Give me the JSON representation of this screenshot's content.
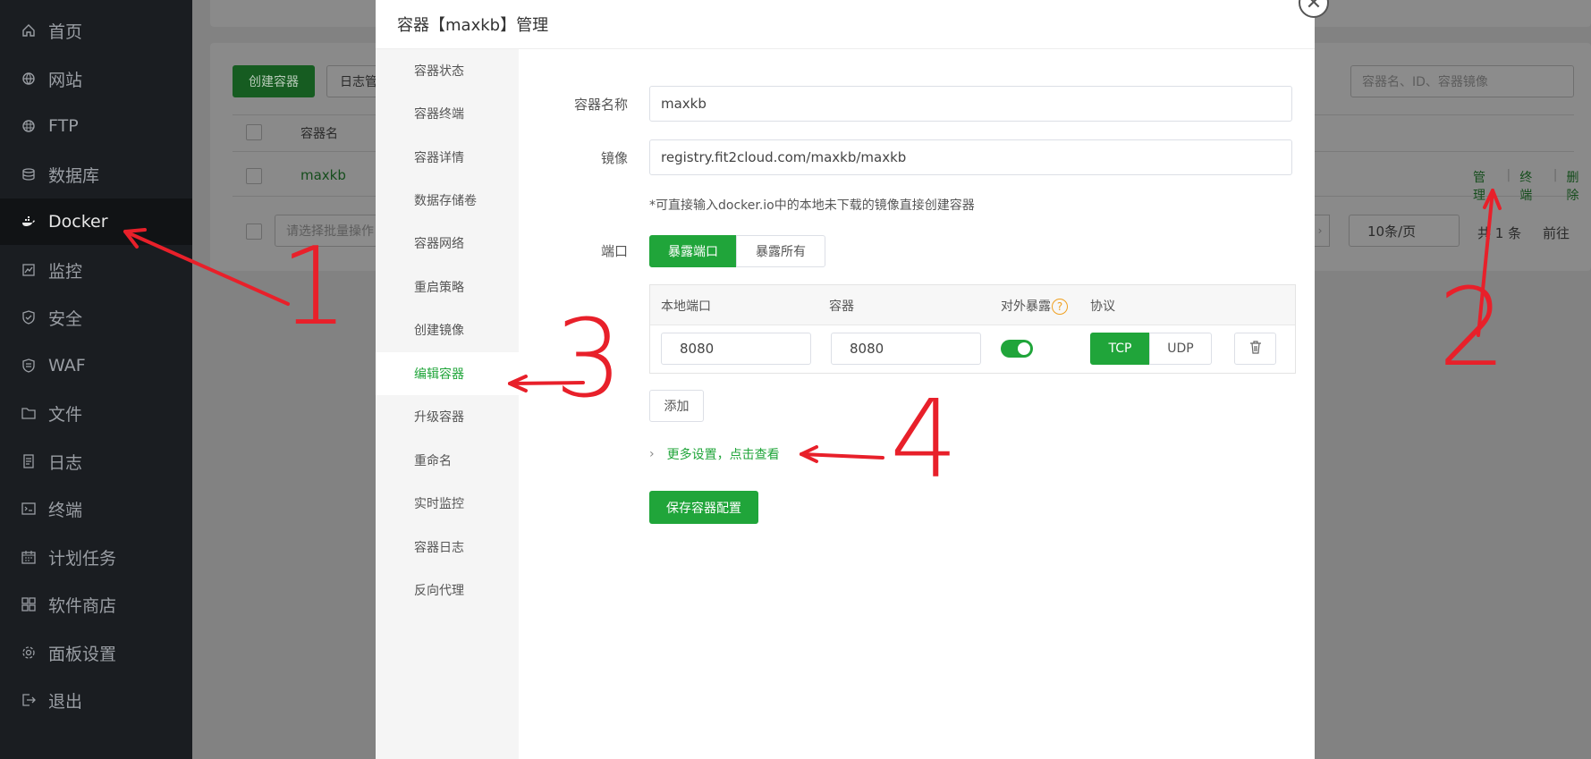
{
  "sidebar": {
    "items": [
      {
        "label": "首页",
        "icon": "home-icon"
      },
      {
        "label": "网站",
        "icon": "globe-icon"
      },
      {
        "label": "FTP",
        "icon": "ftp-icon"
      },
      {
        "label": "数据库",
        "icon": "database-icon"
      },
      {
        "label": "Docker",
        "icon": "docker-icon",
        "active": true
      },
      {
        "label": "监控",
        "icon": "monitor-icon"
      },
      {
        "label": "安全",
        "icon": "shield-icon"
      },
      {
        "label": "WAF",
        "icon": "waf-icon"
      },
      {
        "label": "文件",
        "icon": "folder-icon"
      },
      {
        "label": "日志",
        "icon": "log-icon"
      },
      {
        "label": "终端",
        "icon": "terminal-icon"
      },
      {
        "label": "计划任务",
        "icon": "calendar-icon"
      },
      {
        "label": "软件商店",
        "icon": "apps-icon"
      },
      {
        "label": "面板设置",
        "icon": "gear-icon"
      },
      {
        "label": "退出",
        "icon": "logout-icon"
      }
    ]
  },
  "background": {
    "create_button": "创建容器",
    "log_button": "日志管",
    "search_placeholder": "容器名、ID、容器镜像",
    "column_name": "容器名",
    "row_name": "maxkb",
    "actions": [
      "管理",
      "终端",
      "删除"
    ],
    "batch_placeholder": "请选择批量操作",
    "page_size": "10条/页",
    "total": "共 1 条",
    "goto": "前往"
  },
  "dialog": {
    "title": "容器【maxkb】管理",
    "menu": [
      "容器状态",
      "容器终端",
      "容器详情",
      "数据存储卷",
      "容器网络",
      "重启策略",
      "创建镜像",
      "编辑容器",
      "升级容器",
      "重命名",
      "实时监控",
      "容器日志",
      "反向代理"
    ],
    "active_menu": "编辑容器",
    "form": {
      "name_label": "容器名称",
      "name_value": "maxkb",
      "image_label": "镜像",
      "image_value": "registry.fit2cloud.com/maxkb/maxkb",
      "image_tip": "*可直接输入docker.io中的本地未下载的镜像直接创建容器",
      "port_label": "端口",
      "port_mode_on": "暴露端口",
      "port_mode_off": "暴露所有",
      "table_headers": {
        "local": "本地端口",
        "container": "容器",
        "expose": "对外暴露",
        "protocol": "协议"
      },
      "row": {
        "local": "8080",
        "container": "8080",
        "expose": true,
        "protocol_on": "TCP",
        "protocol_off": "UDP"
      },
      "add_button": "添加",
      "more_settings": "更多设置，点击查看",
      "save_button": "保存容器配置"
    }
  },
  "annotations": [
    "1",
    "2",
    "3",
    "4"
  ],
  "colors": {
    "accent": "#20a53a",
    "annotation": "#e8202a",
    "sidebar": "#1a1d21"
  }
}
